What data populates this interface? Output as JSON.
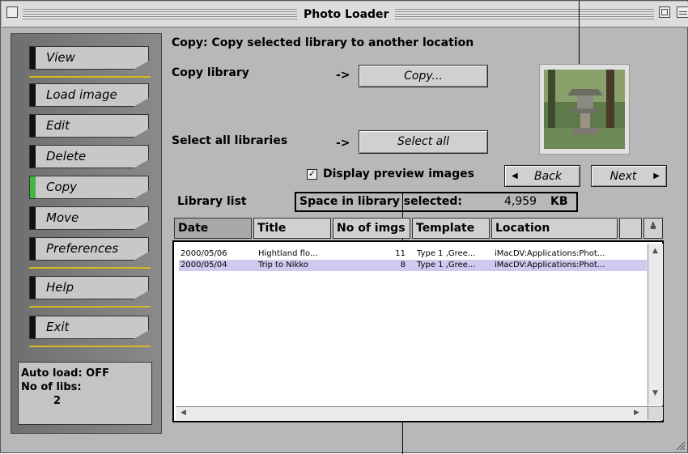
{
  "window": {
    "title": "Photo Loader"
  },
  "sidebar": {
    "items": [
      {
        "label": "View"
      },
      {
        "label": "Load image"
      },
      {
        "label": "Edit"
      },
      {
        "label": "Delete"
      },
      {
        "label": "Copy"
      },
      {
        "label": "Move"
      },
      {
        "label": "Preferences"
      },
      {
        "label": "Help"
      },
      {
        "label": "Exit"
      }
    ],
    "active": "Copy",
    "status": {
      "auto_load": "Auto load: OFF",
      "no_of_libs_label": "No of libs:",
      "no_of_libs_value": "2"
    }
  },
  "main": {
    "heading": "Copy: Copy selected library to another location",
    "copy_library_label": "Copy library",
    "arrow": "->",
    "copy_button": "Copy...",
    "select_all_label": "Select all libraries",
    "select_all_button": "Select all",
    "display_preview": {
      "label": "Display preview images",
      "checked": true,
      "mark": "✓"
    },
    "back_button": "Back",
    "next_button": "Next",
    "library_list_label": "Library list",
    "space_label": "Space in library selected:",
    "space_value": "4,959",
    "space_unit": "KB",
    "columns": [
      "Date",
      "Title",
      "No of imgs",
      "Template",
      "Location"
    ],
    "rows": [
      {
        "date": "2000/05/06",
        "title": "Hightland flo...",
        "count": "11",
        "template": "Type 1 ,Gree...",
        "location": "iMacDV:Applications:Phot...",
        "selected": false
      },
      {
        "date": "2000/05/04",
        "title": "Trip to Nikko",
        "count": "8",
        "template": "Type 1 ,Gree...",
        "location": "iMacDV:Applications:Phot...",
        "selected": true
      }
    ]
  },
  "colors": {
    "active_tab": "#3fb83f",
    "separator": "#d6b822",
    "selected_row": "#cfc9ef"
  }
}
